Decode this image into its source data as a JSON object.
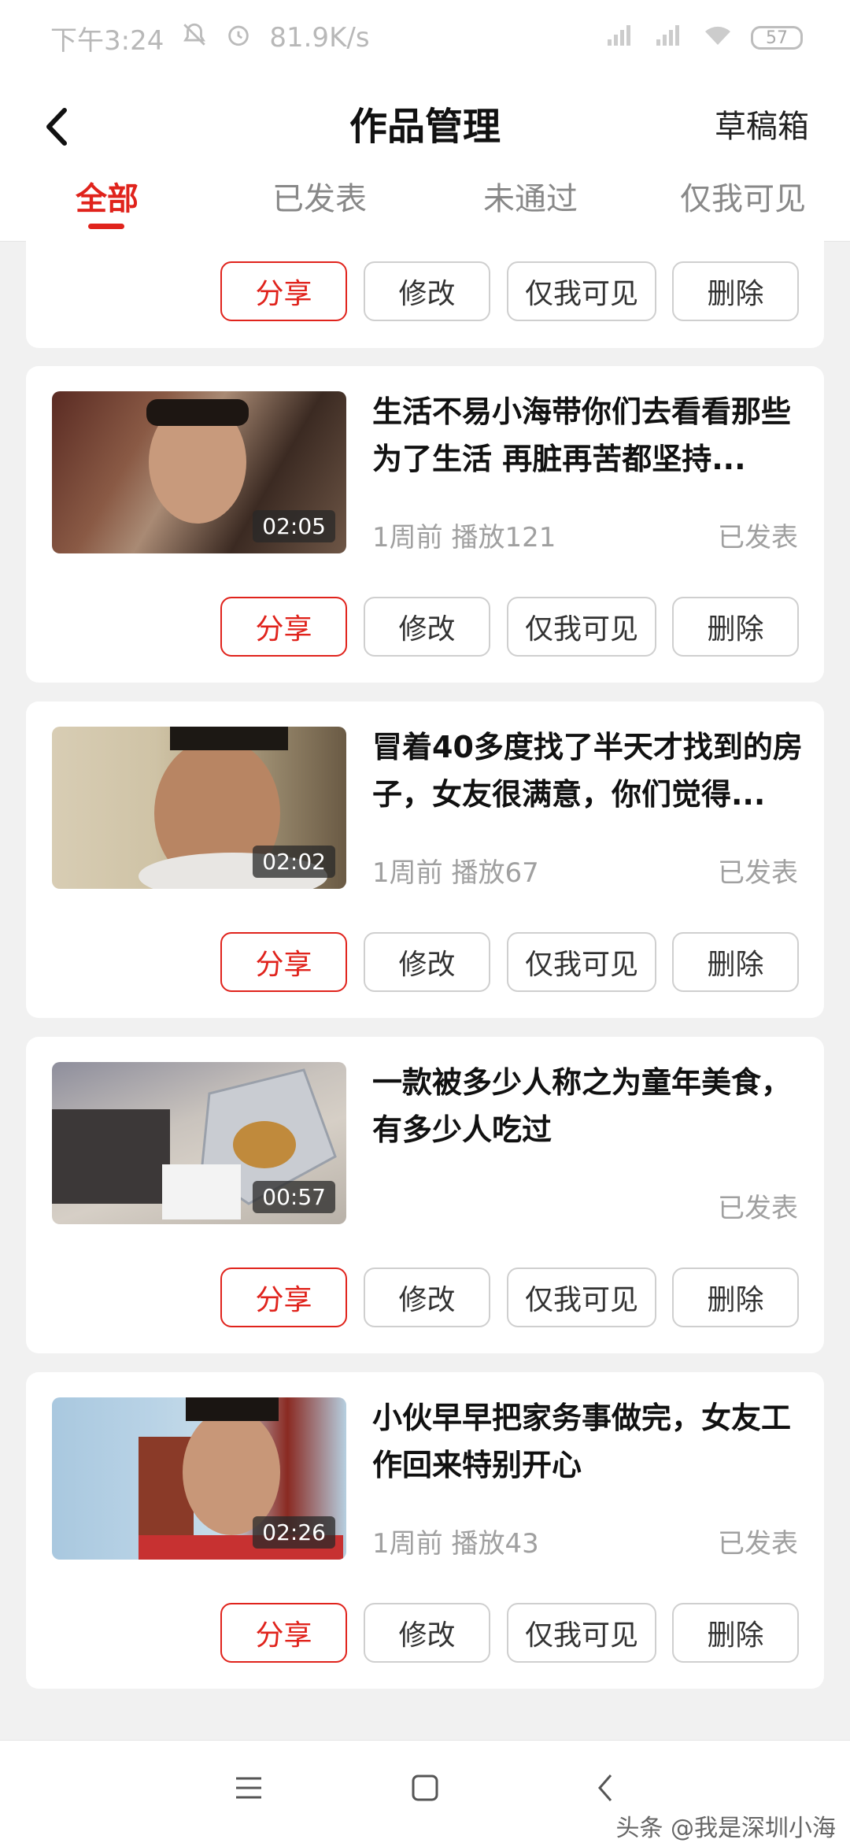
{
  "status_bar": {
    "time": "下午3:24",
    "speed": "81.9K/s",
    "battery": "57"
  },
  "header": {
    "title": "作品管理",
    "drafts_label": "草稿箱"
  },
  "tabs": [
    {
      "label": "全部",
      "active": true
    },
    {
      "label": "已发表",
      "active": false
    },
    {
      "label": "未通过",
      "active": false
    },
    {
      "label": "仅我可见",
      "active": false
    }
  ],
  "buttons": {
    "share": "分享",
    "edit": "修改",
    "private": "仅我可见",
    "delete": "删除"
  },
  "videos": [
    {
      "title": "生活不易小海带你们去看看那些为了生活 再脏再苦都坚持...",
      "duration": "02:05",
      "age": "1周前",
      "plays": "播放121",
      "status": "已发表"
    },
    {
      "title": "冒着40多度找了半天才找到的房子，女友很满意，你们觉得...",
      "duration": "02:02",
      "age": "1周前",
      "plays": "播放67",
      "status": "已发表"
    },
    {
      "title": "一款被多少人称之为童年美食，有多少人吃过",
      "duration": "00:57",
      "age": "",
      "plays": "",
      "status": "已发表"
    },
    {
      "title": "小伙早早把家务事做完，女友工作回来特别开心",
      "duration": "02:26",
      "age": "1周前",
      "plays": "播放43",
      "status": "已发表"
    }
  ],
  "watermark": "头条 @我是深圳小海"
}
